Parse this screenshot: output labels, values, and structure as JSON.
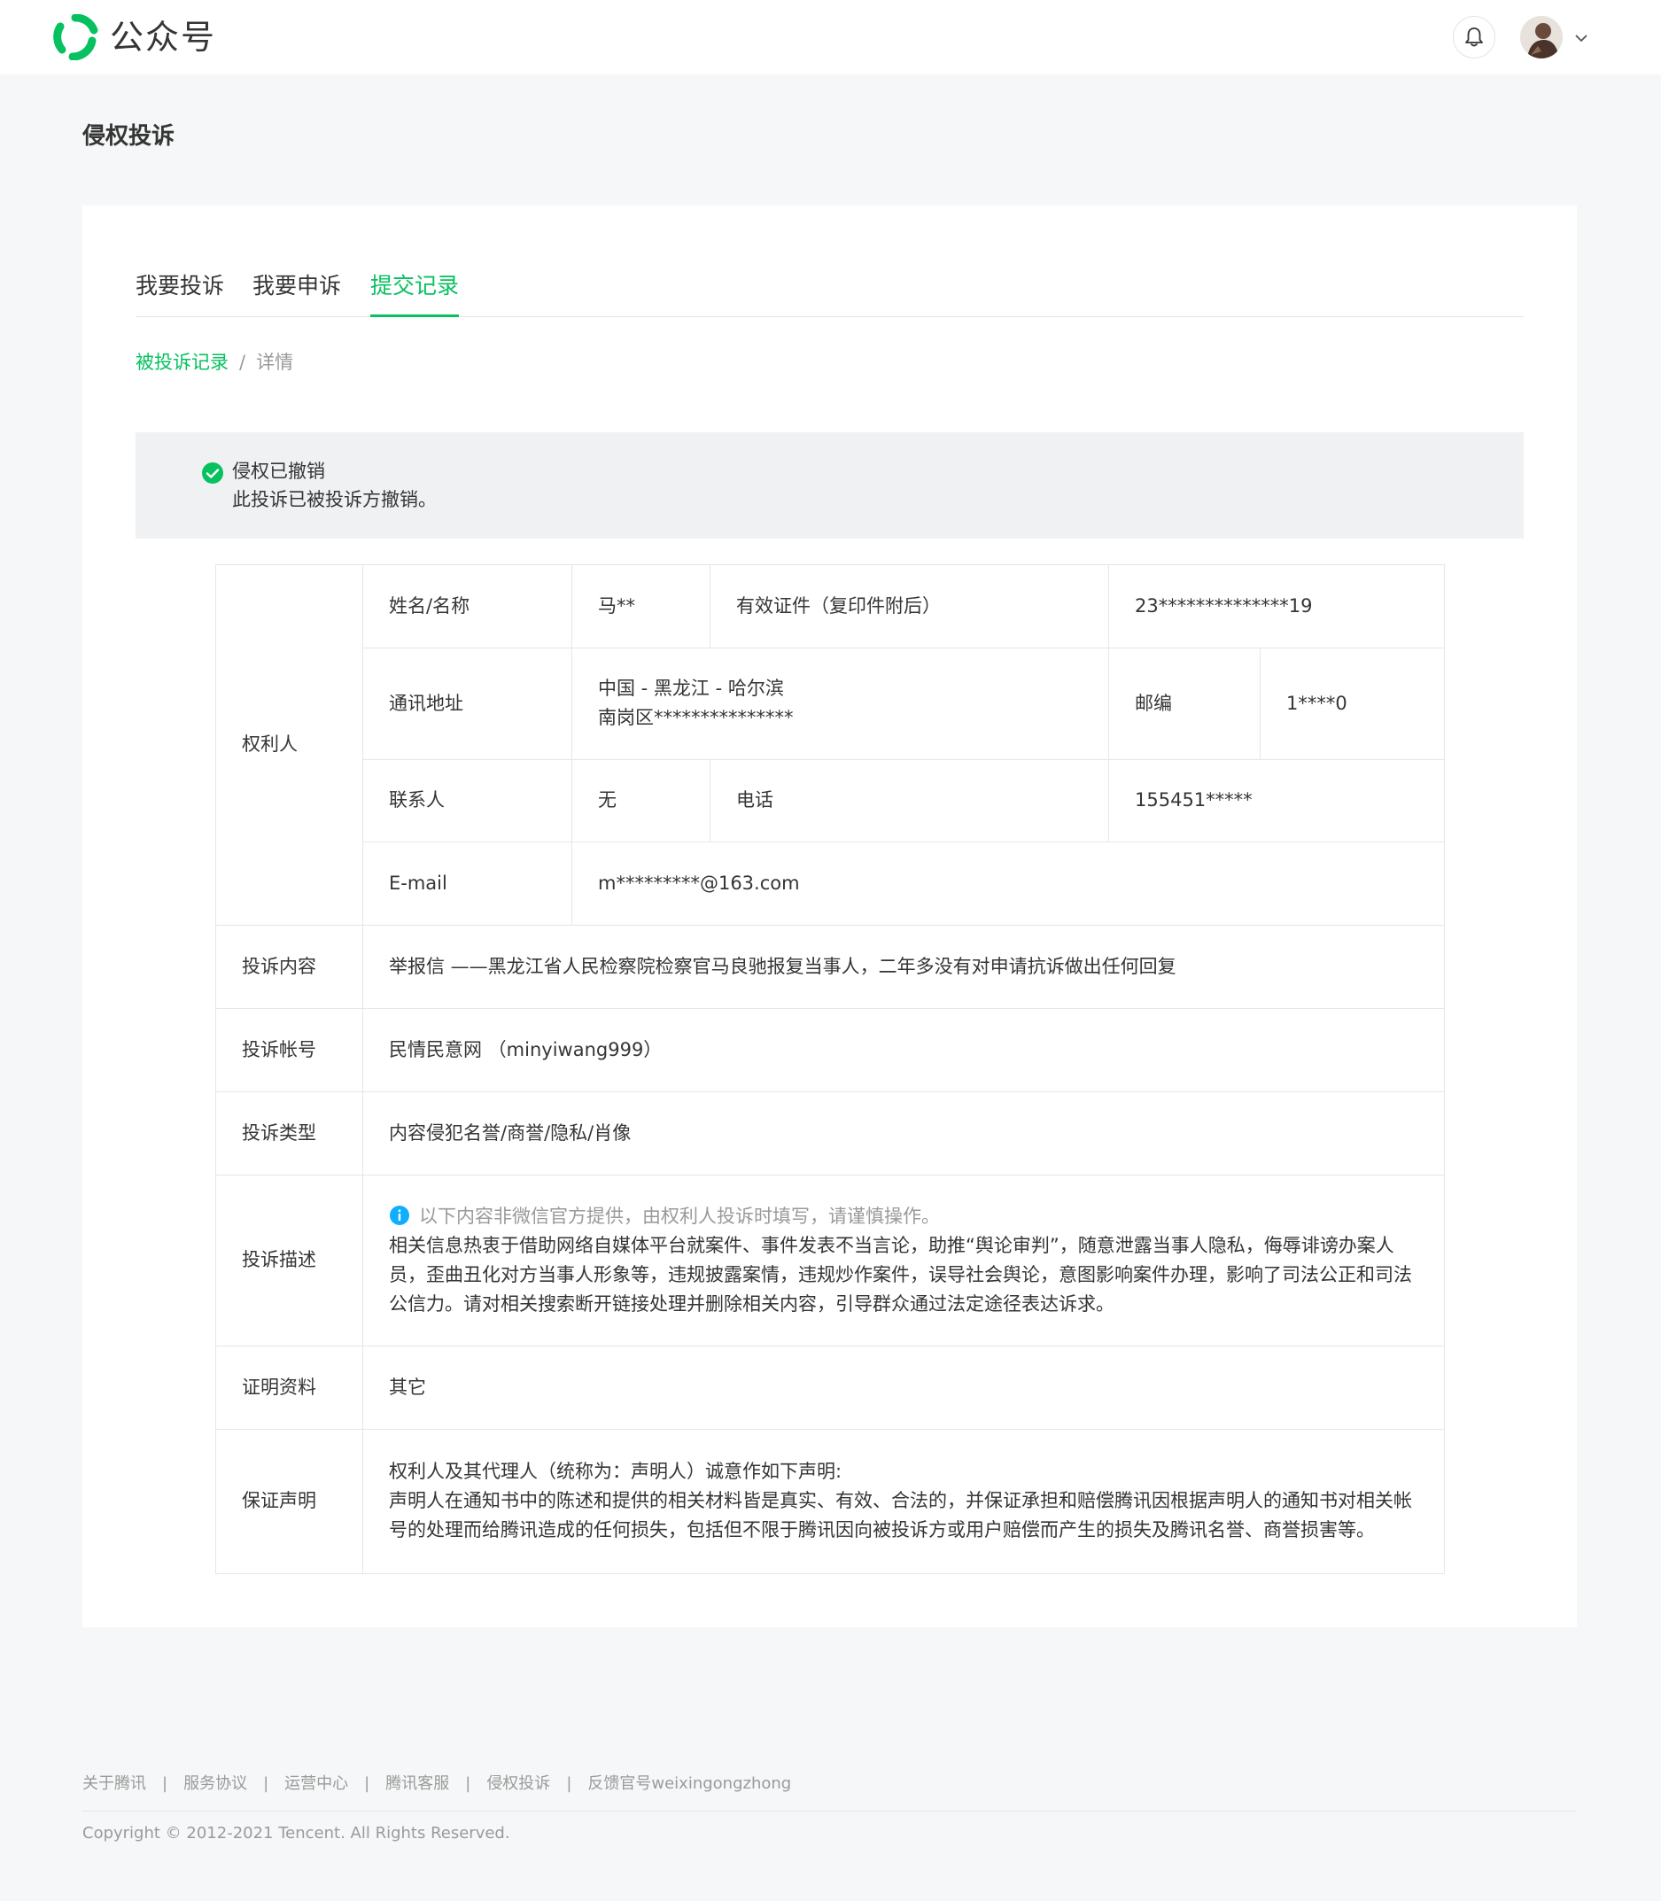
{
  "header": {
    "brand": "公众号",
    "bell_icon": "bell-icon",
    "avatar_icon": "user-avatar",
    "menu_icon": "chevron-down-icon",
    "accent_color": "#07c160"
  },
  "page": {
    "title": "侵权投诉"
  },
  "tabs": [
    {
      "label": "我要投诉"
    },
    {
      "label": "我要申诉"
    },
    {
      "label": "提交记录"
    }
  ],
  "breadcrumb": {
    "parent": "被投诉记录",
    "separator": "/",
    "current": "详情"
  },
  "notice": {
    "icon": "check-circle-icon",
    "title": "侵权已撤销",
    "desc": "此投诉已被投诉方撤销。"
  },
  "table": {
    "owner_label": "权利人",
    "name_label": "姓名/名称",
    "name_value": "马**",
    "id_label": "有效证件（复印件附后）",
    "id_value": "23**************19",
    "address_label": "通讯地址",
    "address_line1": "中国 - 黑龙江 - 哈尔滨",
    "address_line2": "南岗区***************",
    "zip_label": "邮编",
    "zip_value": "1****0",
    "contact_label": "联系人",
    "contact_value": "无",
    "phone_label": "电话",
    "phone_value": "155451*****",
    "email_label": "E-mail",
    "email_value": "m*********@163.com",
    "content_label": "投诉内容",
    "content_value": "举报信 ——黑龙江省人民检察院检察官马良驰报复当事人，二年多没有对申请抗诉做出任何回复",
    "account_label": "投诉帐号",
    "account_value": "民情民意网 （minyiwang999）",
    "type_label": "投诉类型",
    "type_value": "内容侵犯名誉/商誉/隐私/肖像",
    "desc_label": "投诉描述",
    "desc_hint": "以下内容非微信官方提供，由权利人投诉时填写，请谨慎操作。",
    "desc_line1": "相关信息热衷于借助网络自媒体平台就案件、事件发表不当言论，助推“舆论审判”，随意泄露当事人隐私，侮辱诽谤办案人",
    "desc_line2": "员，歪曲丑化对方当事人形象等，违规披露案情，违规炒作案件，误导社会舆论，意图影响案件办理，影响了司法公正和司法",
    "desc_line3": "公信力。请对相关搜索断开链接处理并删除相关内容，引导群众通过法定途径表达诉求。",
    "proof_label": "证明资料",
    "proof_value": "其它",
    "guarantee_label": "保证声明",
    "guarantee_line1": "权利人及其代理人（统称为：声明人）诚意作如下声明:",
    "guarantee_line2": "声明人在通知书中的陈述和提供的相关材料皆是真实、有效、合法的，并保证承担和赔偿腾讯因根据声明人的通知书对相关帐",
    "guarantee_line3": "号的处理而给腾讯造成的任何损失，包括但不限于腾讯因向被投诉方或用户赔偿而产生的损失及腾讯名誉、商誉损害等。"
  },
  "footer": {
    "links": [
      "关于腾讯",
      "服务协议",
      "运营中心",
      "腾讯客服",
      "侵权投诉",
      "反馈官号weixingongzhong"
    ],
    "separator": "|",
    "copyright": "Copyright © 2012-2021 Tencent. All Rights Reserved."
  }
}
